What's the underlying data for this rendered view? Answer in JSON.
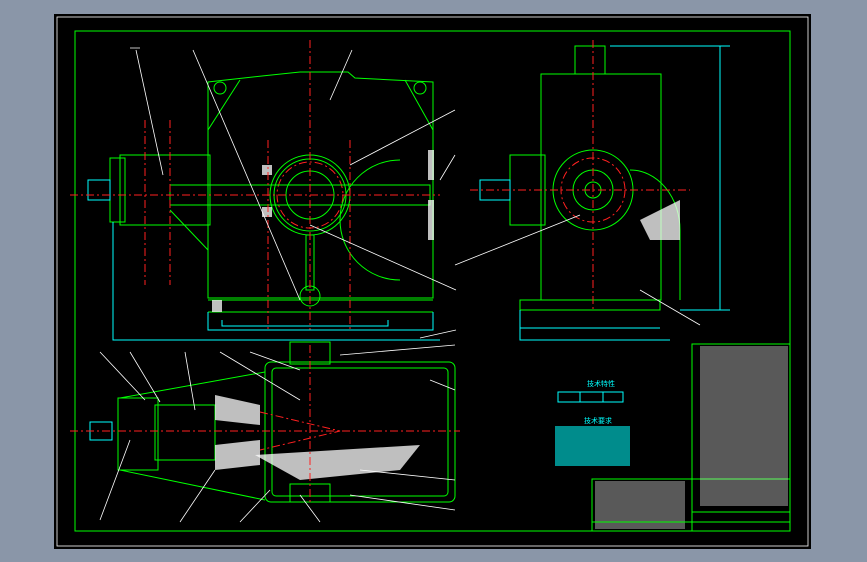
{
  "drawing": {
    "background": "#000000",
    "frame_color": "#00ff00",
    "centerline_color": "#ff2020",
    "dimension_color": "#00ffff",
    "leader_color": "#ffffff"
  },
  "notes": {
    "characteristics_title": "技术特性",
    "requirements_title": "技术要求"
  }
}
